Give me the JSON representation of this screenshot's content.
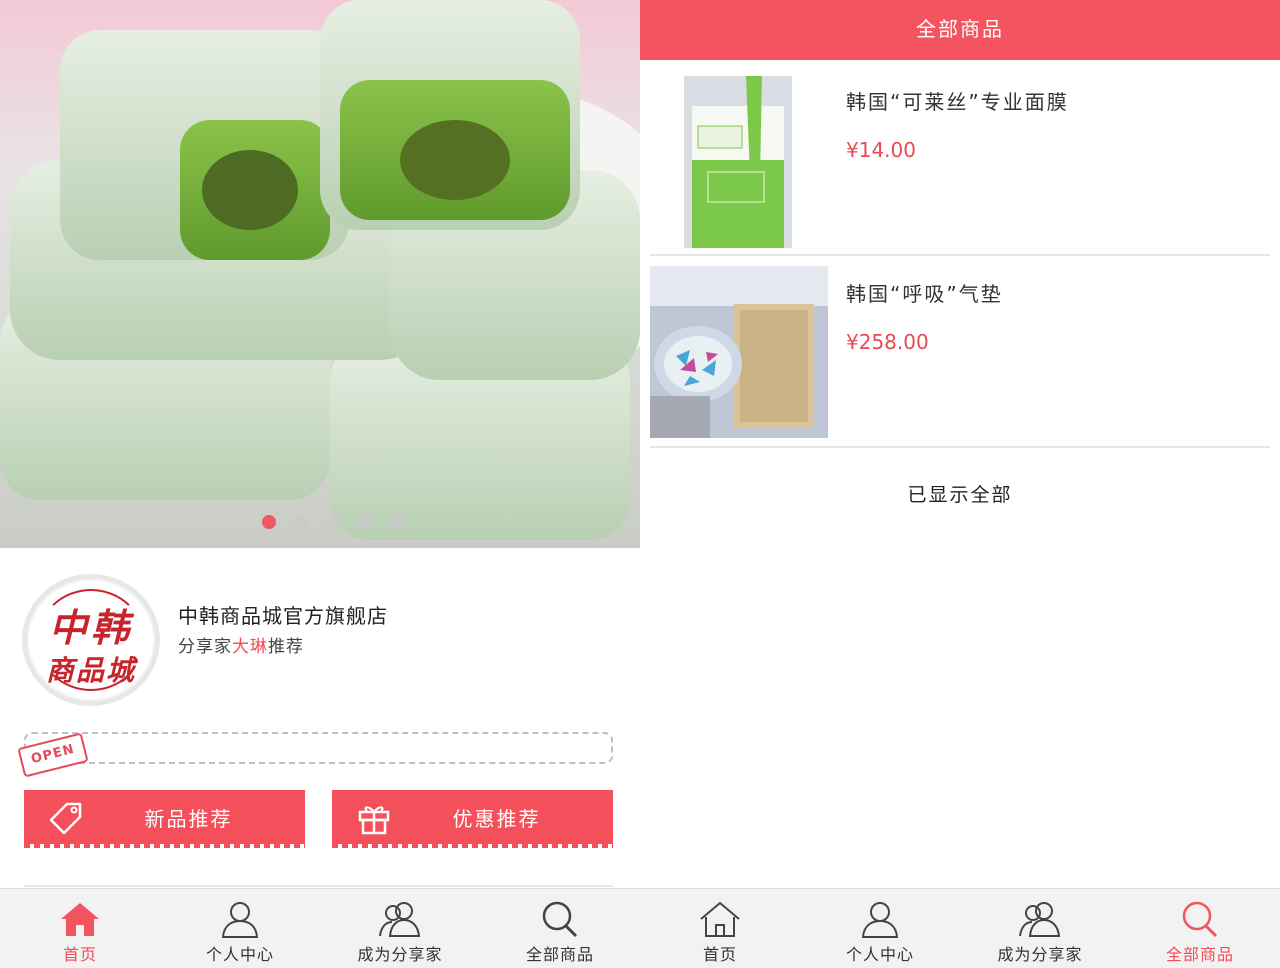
{
  "left": {
    "banner": {
      "dots_total": 5,
      "active_dot": 0
    },
    "shop": {
      "logo_line1": "中韩",
      "logo_line2": "商品城",
      "name": "中韩商品城官方旗舰店",
      "sharer_prefix": "分享家",
      "sharer_name": "大琳",
      "sharer_suffix": "推荐"
    },
    "open_tag": "OPEN",
    "buttons": {
      "new_label": "新品推荐",
      "promo_label": "优惠推荐"
    },
    "tabs": [
      {
        "label": "首页",
        "icon": "home-icon",
        "active": true
      },
      {
        "label": "个人中心",
        "icon": "person-icon",
        "active": false
      },
      {
        "label": "成为分享家",
        "icon": "group-icon",
        "active": false
      },
      {
        "label": "全部商品",
        "icon": "search-icon",
        "active": false
      }
    ]
  },
  "right": {
    "title": "全部商品",
    "products": [
      {
        "name": "韩国“可莱丝”专业面膜",
        "price": "¥14.00"
      },
      {
        "name": "韩国“呼吸”气垫",
        "price": "¥258.00"
      }
    ],
    "end_text": "已显示全部",
    "tabs": [
      {
        "label": "首页",
        "icon": "home-icon",
        "active": false
      },
      {
        "label": "个人中心",
        "icon": "person-icon",
        "active": false
      },
      {
        "label": "成为分享家",
        "icon": "group-icon",
        "active": false
      },
      {
        "label": "全部商品",
        "icon": "search-icon",
        "active": true
      }
    ]
  },
  "colors": {
    "accent": "#f4545f",
    "price": "#e84a52",
    "tab_bg": "#f2f2f2"
  }
}
